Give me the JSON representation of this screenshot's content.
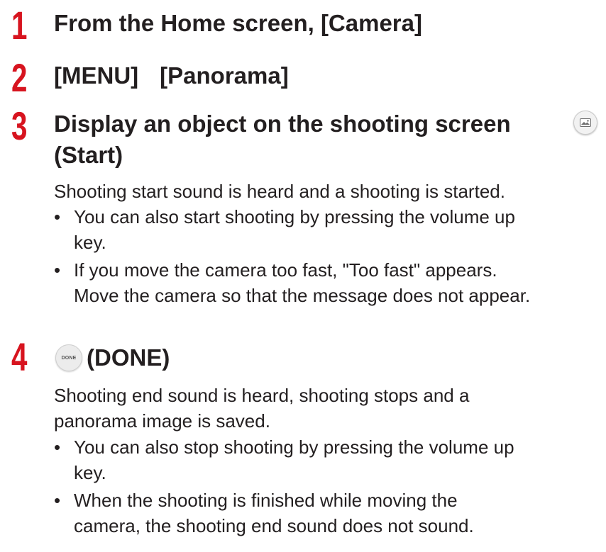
{
  "steps": [
    {
      "number": "1",
      "title": "From the Home screen, [Camera]"
    },
    {
      "number": "2",
      "title_part1": "[MENU]",
      "title_part2": "[Panorama]"
    },
    {
      "number": "3",
      "title_line1": "Display an object on the shooting screen",
      "title_line2": "(Start)",
      "icon": "panorama-shutter-icon",
      "description": "Shooting start sound is heard and a shooting is started.",
      "bullets": [
        {
          "mark": "•",
          "line1": "You can also start shooting by pressing the volume up",
          "line2": "key."
        },
        {
          "mark": "•",
          "line1": "If you move the camera too fast, \"Too fast\" appears.",
          "line2": "Move the camera so that the message does not appear."
        }
      ]
    },
    {
      "number": "4",
      "title": "(DONE)",
      "icon_label": "DONE",
      "description_line1": "Shooting end sound is heard, shooting stops and a",
      "description_line2": "panorama image is saved.",
      "bullets": [
        {
          "mark": "•",
          "line1": "You can also stop shooting by pressing the volume up",
          "line2": "key."
        },
        {
          "mark": "•",
          "line1": "When the shooting is finished while moving the",
          "line2": "camera, the shooting end sound does not sound."
        }
      ]
    }
  ],
  "colors": {
    "step_number": "#d7141f",
    "text": "#231f20"
  }
}
